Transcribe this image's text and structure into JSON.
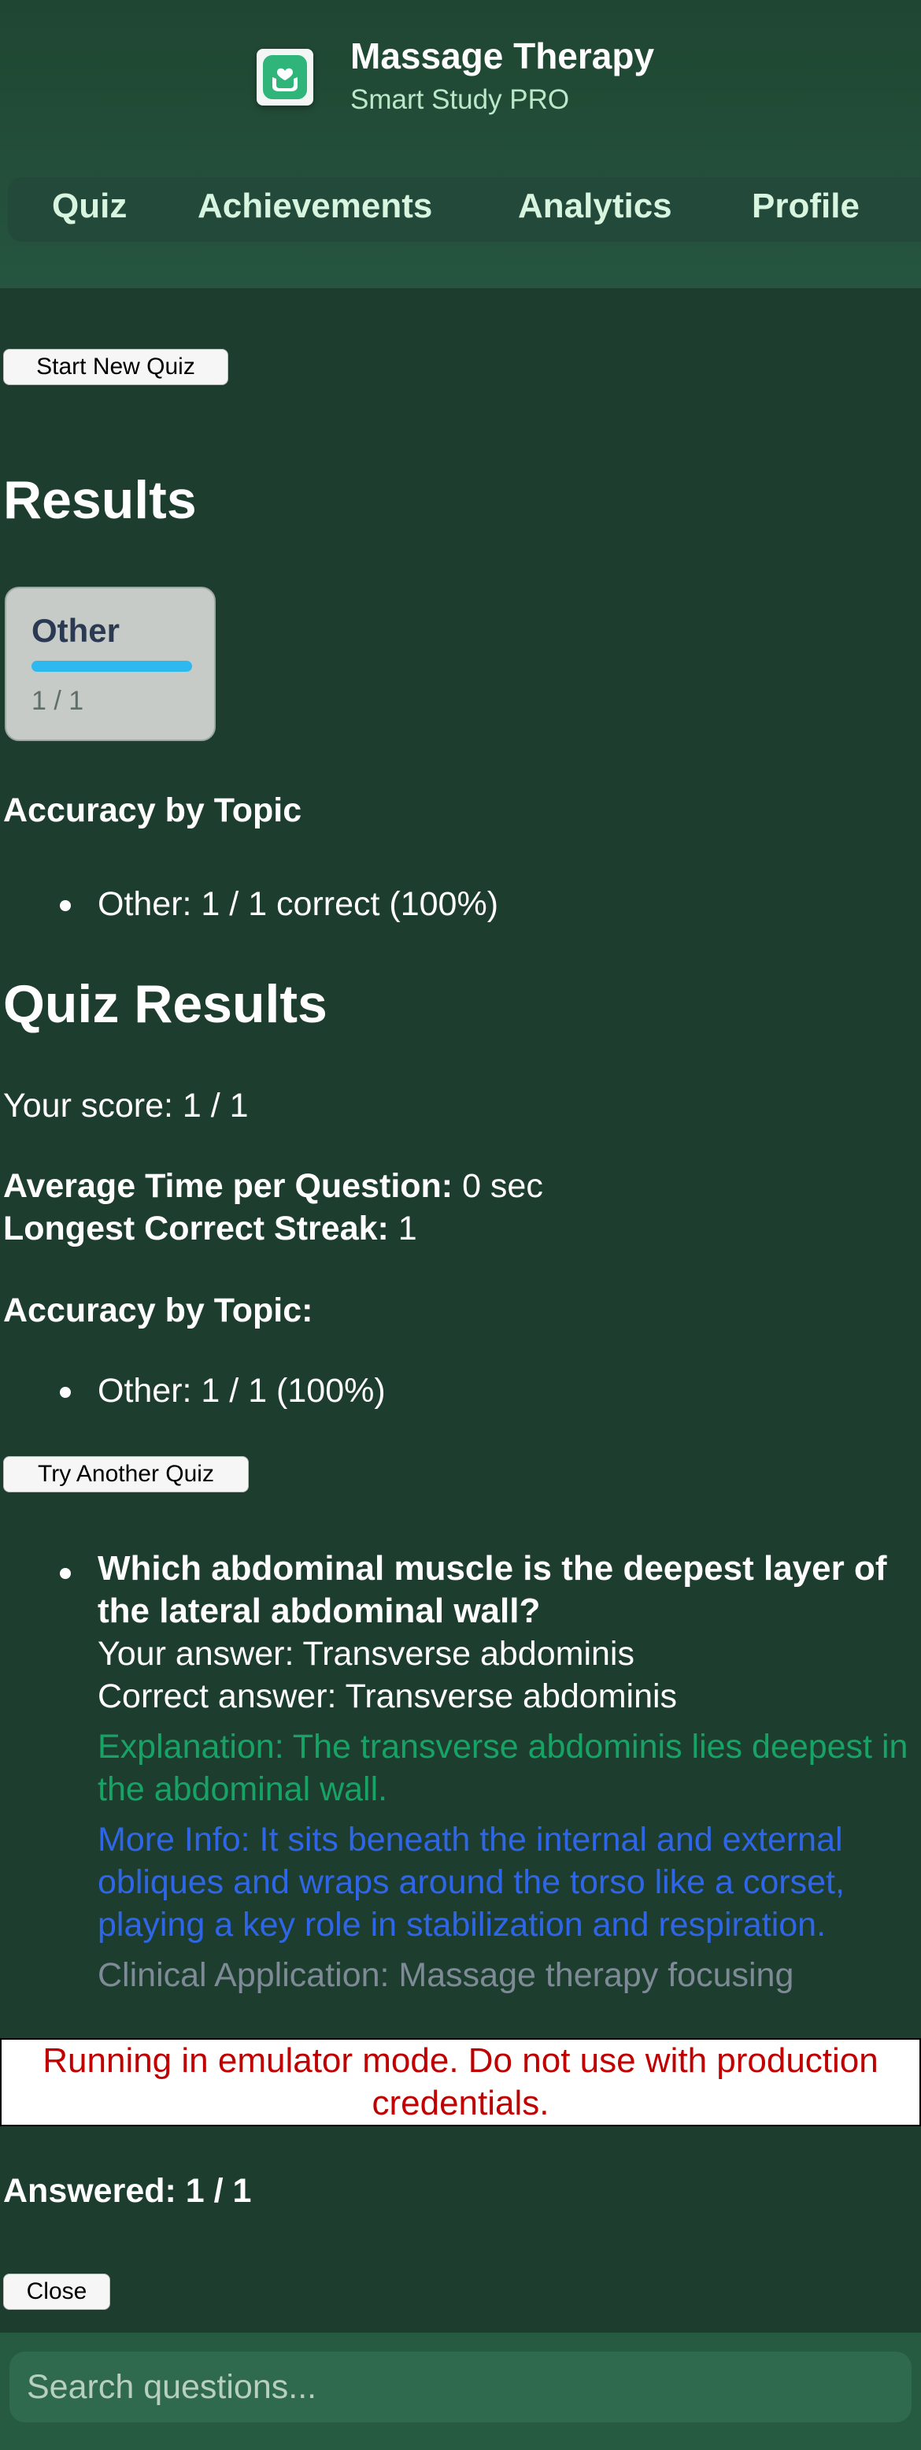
{
  "header": {
    "logo_icon": "hands-heart-icon",
    "title": "Massage Therapy",
    "subtitle": "Smart Study PRO"
  },
  "nav": {
    "tabs": [
      {
        "label": "Quiz"
      },
      {
        "label": "Achievements"
      },
      {
        "label": "Analytics"
      },
      {
        "label": "Profile"
      }
    ]
  },
  "actions": {
    "start_new_quiz": "Start New Quiz",
    "try_another_quiz": "Try Another Quiz",
    "close": "Close"
  },
  "results": {
    "heading": "Results",
    "topic_card": {
      "name": "Other",
      "count": "1 / 1",
      "progress_fraction": 1.0,
      "bar_color": "#2db9ef"
    },
    "accuracy_heading": "Accuracy by Topic",
    "accuracy_items": [
      "Other: 1 / 1 correct (100%)"
    ]
  },
  "quiz_results": {
    "heading": "Quiz Results",
    "score": "Your score: 1 / 1",
    "avg_time_label": "Average Time per Question:",
    "avg_time_value": " 0 sec",
    "streak_label": "Longest Correct Streak:",
    "streak_value": " 1",
    "accuracy_heading": "Accuracy by Topic:",
    "accuracy_items": [
      "Other: 1 / 1 (100%)"
    ]
  },
  "review": {
    "questions": [
      {
        "question": "Which abdominal muscle is the deepest layer of the lateral abdominal wall?",
        "your_answer": "Your answer: Transverse abdominis",
        "correct_answer": "Correct answer: Transverse abdominis",
        "explanation": "Explanation: The transverse abdominis lies deepest in the abdominal wall.",
        "more_info": "More Info: It sits beneath the internal and external obliques and wraps around the torso like a corset, playing a key role in stabilization and respiration.",
        "clinical_application": "Clinical Application: Massage therapy focusing"
      }
    ],
    "answered": "Answered: 1 / 1"
  },
  "emulator_banner": "Running in emulator mode. Do not use with production credentials.",
  "search": {
    "placeholder": "Search questions..."
  },
  "colors": {
    "background": "#1d3d2f",
    "explanation": "#17a366",
    "more_info": "#2f66e8",
    "banner_text": "#c00000"
  }
}
